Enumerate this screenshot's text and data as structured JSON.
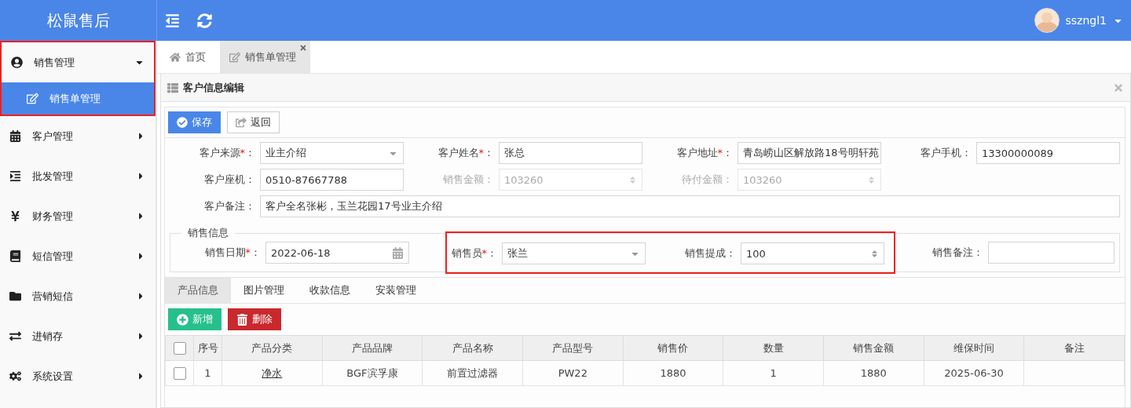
{
  "app": {
    "logo": "松鼠售后",
    "user": "sszngl1"
  },
  "sidebar": {
    "items": [
      {
        "label": "销售管理",
        "expanded": true,
        "highlighted": true,
        "children": [
          {
            "label": "销售单管理",
            "selected": true
          }
        ]
      },
      {
        "label": "客户管理",
        "expanded": false,
        "highlighted": false
      },
      {
        "label": "批发管理",
        "expanded": false,
        "highlighted": false
      },
      {
        "label": "财务管理",
        "expanded": false,
        "highlighted": false
      },
      {
        "label": "短信管理",
        "expanded": false,
        "highlighted": false
      },
      {
        "label": "营销短信",
        "expanded": false,
        "highlighted": false
      },
      {
        "label": "进销存",
        "expanded": false,
        "highlighted": false
      },
      {
        "label": "系统设置",
        "expanded": false,
        "highlighted": false
      }
    ]
  },
  "tabs": [
    {
      "label": "首页",
      "selected": false,
      "closable": false
    },
    {
      "label": "销售单管理",
      "selected": true,
      "closable": true
    }
  ],
  "panel": {
    "title": "客户信息编辑",
    "toolbar": [
      {
        "label": "保存",
        "kind": "primary"
      },
      {
        "label": "返回",
        "kind": "outline"
      }
    ],
    "fields": [
      {
        "label": "客户来源",
        "required_mark": "*",
        "suffix": "：",
        "kind": "select",
        "value": "业主介绍",
        "disabled": false
      },
      {
        "label": "客户姓名",
        "required_mark": "*",
        "suffix": "：",
        "kind": "text",
        "value": "张总",
        "disabled": false
      },
      {
        "label": "客户地址",
        "required_mark": "*",
        "suffix": "：",
        "kind": "text",
        "value": "青岛崂山区解放路18号明轩苑",
        "disabled": false
      },
      {
        "label": "客户手机",
        "suffix": "：",
        "kind": "text",
        "value": "13300000089",
        "disabled": false
      },
      {
        "label": "客户座机",
        "suffix": "：",
        "kind": "text",
        "value": "0510-87667788",
        "disabled": false
      },
      {
        "label": "销售金额",
        "suffix": "：",
        "kind": "spinner",
        "value": "103260",
        "disabled": true
      },
      {
        "label": "待付金额",
        "suffix": "：",
        "kind": "spinner",
        "value": "103260",
        "disabled": true
      },
      {
        "label": "客户备注",
        "suffix": "：",
        "kind": "wide",
        "value": "客户全名张彬，玉兰花园17号业主介绍",
        "disabled": false
      }
    ],
    "sales_info": {
      "legend": "销售信息",
      "fields": [
        {
          "label": "销售日期",
          "required_mark": "*",
          "suffix": "：",
          "kind": "date",
          "value": "2022-06-18",
          "highlighted": false
        },
        {
          "label": "销售员",
          "required_mark": "*",
          "suffix": "：",
          "kind": "select",
          "value": "张兰",
          "highlighted": true
        },
        {
          "label": "销售提成",
          "suffix": "：",
          "kind": "spinner",
          "value": "100",
          "highlighted": true
        },
        {
          "label": "销售备注",
          "suffix": "：",
          "kind": "text",
          "highlighted": false
        }
      ]
    },
    "subtabs": [
      {
        "label": "产品信息",
        "selected": true
      },
      {
        "label": "图片管理",
        "selected": false
      },
      {
        "label": "收款信息",
        "selected": false
      },
      {
        "label": "安装管理",
        "selected": false
      }
    ],
    "actions": [
      {
        "label": "新增",
        "kind": "add"
      },
      {
        "label": "删除",
        "kind": "delete"
      }
    ],
    "table": {
      "all_checked": false,
      "columns": [
        "序号",
        "产品分类",
        "产品品牌",
        "产品名称",
        "产品型号",
        "销售价",
        "数量",
        "销售金额",
        "维保时间",
        "备注"
      ],
      "rows": [
        {
          "checked": false,
          "cells": [
            "1",
            "净水",
            "BGF滨孚康",
            "前置过滤器",
            "PW22",
            "1880",
            "1",
            "1880",
            "2025-06-30",
            ""
          ]
        }
      ]
    }
  }
}
